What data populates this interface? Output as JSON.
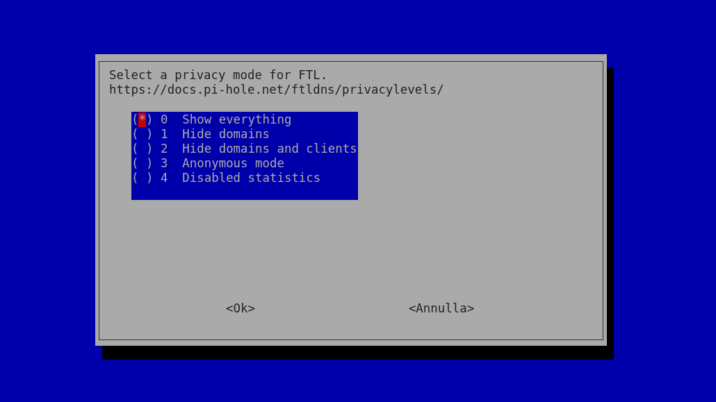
{
  "dialog": {
    "message": "Select a privacy mode for FTL.",
    "link": "https://docs.pi-hole.net/ftldns/privacylevels/"
  },
  "radio": {
    "open": "(",
    "close": ")",
    "mark": "*"
  },
  "options": [
    {
      "key": "0",
      "label": "Show everything",
      "selected": true,
      "focused": true
    },
    {
      "key": "1",
      "label": "Hide domains",
      "selected": false,
      "focused": false
    },
    {
      "key": "2",
      "label": "Hide domains and clients",
      "selected": false,
      "focused": false
    },
    {
      "key": "3",
      "label": "Anonymous mode",
      "selected": false,
      "focused": false
    },
    {
      "key": "4",
      "label": "Disabled statistics",
      "selected": false,
      "focused": false
    }
  ],
  "buttons": [
    "<Ok>",
    "<Annulla>"
  ]
}
